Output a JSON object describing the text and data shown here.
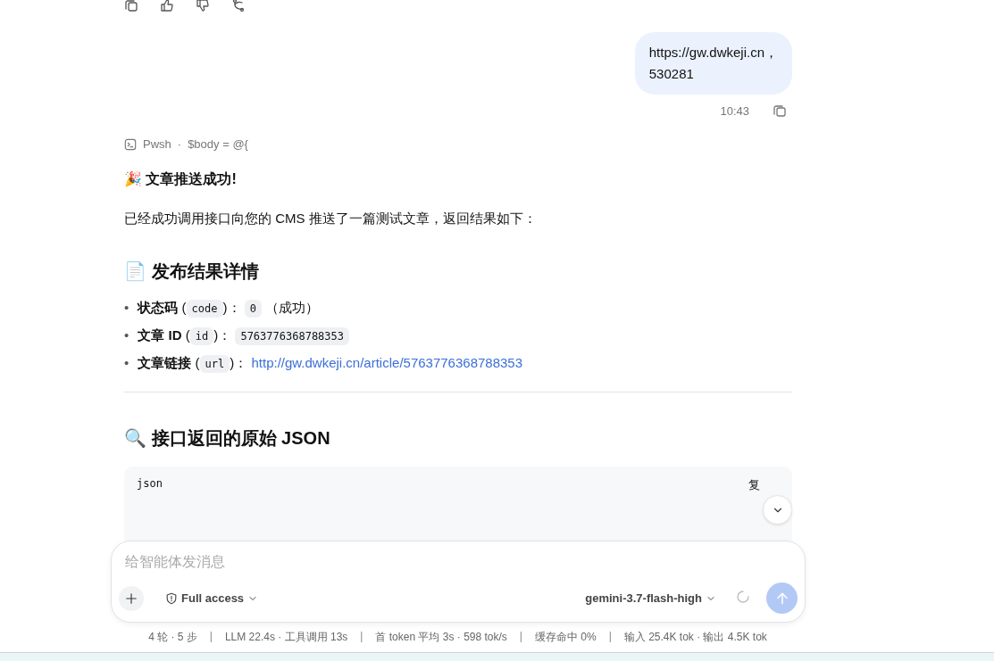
{
  "user_message": {
    "lines": [
      "https://gw.dwkeji.cn，",
      "530281"
    ],
    "time": "10:43"
  },
  "tool_call": {
    "name": "Pwsh",
    "separator": "·",
    "detail": "$body = @{"
  },
  "reply": {
    "title": "🎉 文章推送成功!",
    "intro": "已经成功调用接口向您的 CMS 推送了一篇测试文章，返回结果如下：",
    "section1": "📄 发布结果详情",
    "items": [
      {
        "bullet": "•",
        "label": "状态码",
        "open": "(",
        "key": "code",
        "close": ")：",
        "value": "0",
        "kind": "code",
        "note": "（成功）"
      },
      {
        "bullet": "•",
        "label": "文章 ID",
        "open": "(",
        "key": "id",
        "close": ")：",
        "value": "5763776368788353",
        "kind": "code"
      },
      {
        "bullet": "•",
        "label": "文章链接",
        "open": "(",
        "key": "url",
        "close": ")：",
        "value": "http://gw.dwkeji.cn/article/5763776368788353",
        "kind": "link"
      }
    ],
    "section2": "🔍 接口返回的原始 JSON",
    "code_block": {
      "language": "json",
      "copy": "复"
    }
  },
  "composer": {
    "placeholder": "给智能体发消息",
    "access": "Full access",
    "model": "gemini-3.7-flash-high"
  },
  "stats": [
    {
      "text": "4 轮 · 5 步"
    },
    {
      "separator": "|",
      "text": "LLM 22.4s · 工具调用 13s"
    },
    {
      "separator": "|",
      "text": "首 token 平均 3s · 598 tok/s"
    },
    {
      "separator": "|",
      "text": "缓存命中 0%"
    },
    {
      "separator": "|",
      "text": "输入 25.4K tok · 输出 4.5K tok"
    }
  ]
}
